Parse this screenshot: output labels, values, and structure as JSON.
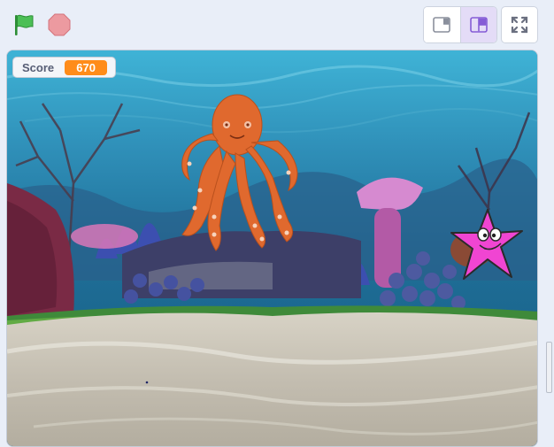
{
  "toolbar": {
    "green_flag_icon": "green-flag-icon",
    "stop_icon": "stop-sign-icon",
    "small_stage_icon": "small-stage-layout-icon",
    "large_stage_icon": "large-stage-layout-icon",
    "fullscreen_icon": "fullscreen-icon",
    "active_layout": "large-stage"
  },
  "monitor": {
    "label": "Score",
    "value": "670",
    "value_color": "#ff8c1a"
  },
  "sprites": [
    {
      "name": "octopus",
      "color": "#e0692e"
    },
    {
      "name": "starfish",
      "color": "#f045d2"
    }
  ],
  "colors": {
    "flag": "#4cbf56",
    "stop": "#ec9aa0",
    "accent": "#855cd6"
  }
}
